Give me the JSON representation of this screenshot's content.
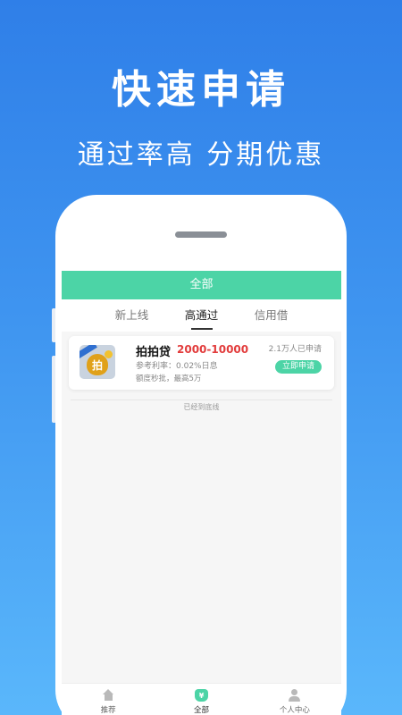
{
  "promo": {
    "headline": "快速申请",
    "subline": "通过率高  分期优惠"
  },
  "header": {
    "title": "全部"
  },
  "tabs": [
    {
      "label": "新上线",
      "active": false
    },
    {
      "label": "高通过",
      "active": true
    },
    {
      "label": "信用借",
      "active": false
    }
  ],
  "loan_card": {
    "logo_char": "拍",
    "name": "拍拍贷",
    "amount_range": "2000-10000",
    "rate": "参考利率：0.02%日息",
    "features": "额度秒批，最高5万",
    "applicants": "2.1万人已申请",
    "apply_label": "立即申请"
  },
  "list_end": "已经到底线",
  "bottom_nav": [
    {
      "label": "推荐",
      "icon": "home-icon"
    },
    {
      "label": "全部",
      "icon": "money-bag-icon",
      "glyph": "¥"
    },
    {
      "label": "个人中心",
      "icon": "user-icon"
    }
  ],
  "colors": {
    "accent": "#4cd4a6",
    "amount": "#e23c3c",
    "background_top": "#2f7fe8",
    "background_bottom": "#5ab7fb"
  }
}
